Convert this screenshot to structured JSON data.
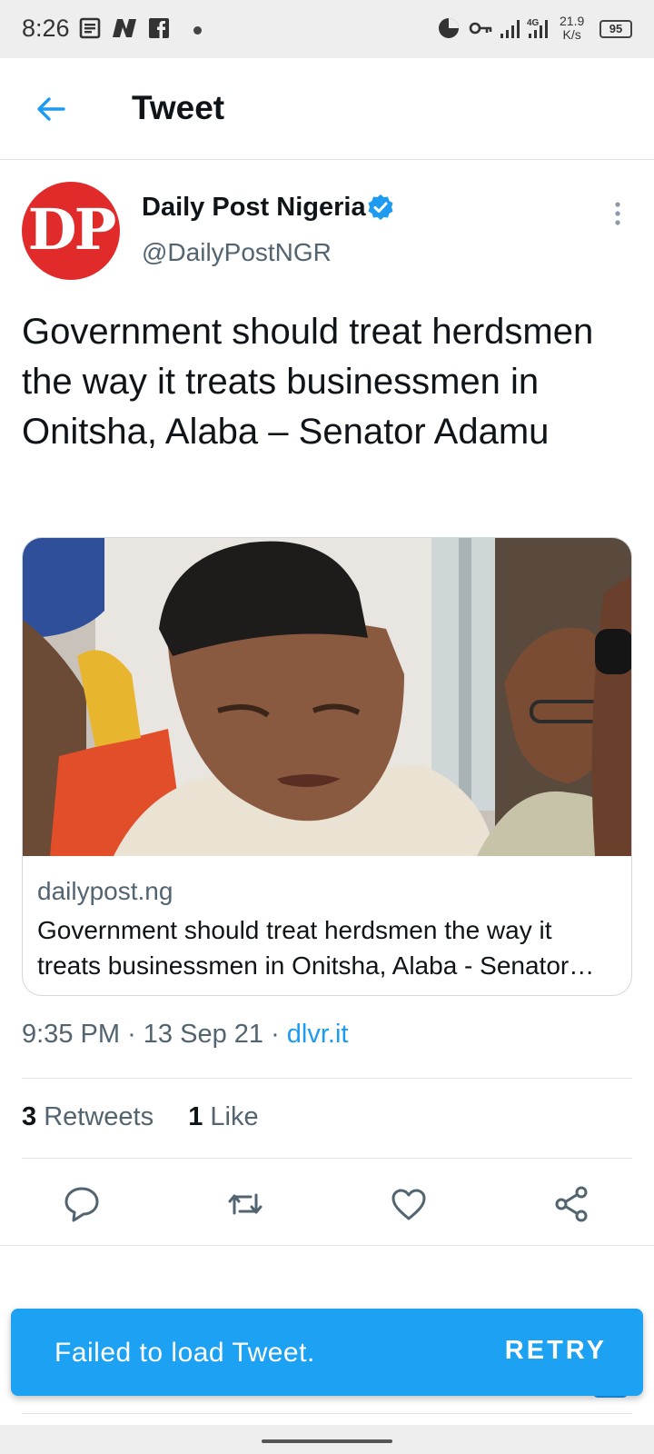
{
  "status_bar": {
    "time": "8:26",
    "network_speed_value": "21.9",
    "network_speed_unit": "K/s",
    "battery": "95",
    "icons": [
      "notes-icon",
      "news-icon",
      "facebook-icon",
      "dot-icon",
      "data-saver-icon",
      "vpn-key-icon",
      "signal-icon",
      "4g-signal-icon",
      "battery-icon"
    ]
  },
  "header": {
    "title": "Tweet",
    "back_icon": "arrow-left-icon"
  },
  "author": {
    "avatar_text": "DP",
    "name": "Daily Post Nigeria",
    "handle": "@DailyPostNGR",
    "verified": true
  },
  "tweet": {
    "text": "Government should treat herdsmen the way it treats businessmen in Onitsha, Alaba – Senator Adamu",
    "time": "9:35 PM",
    "date": "13 Sep 21",
    "source": "dlvr.it"
  },
  "card": {
    "domain": "dailypost.ng",
    "title": "Government should treat herdsmen the way it treats businessmen in Onitsha, Alaba - Senator…"
  },
  "stats": {
    "retweets_count": "3",
    "retweets_label": "Retweets",
    "likes_count": "1",
    "likes_label": "Like"
  },
  "actions": [
    "reply-icon",
    "retweet-icon",
    "like-icon",
    "share-icon"
  ],
  "snackbar": {
    "message": "Failed to load Tweet.",
    "action": "RETRY"
  },
  "colors": {
    "accent": "#1d9bf0",
    "snackbar": "#1da1f2",
    "brand_red": "#e12a2a",
    "secondary_text": "#536471"
  }
}
